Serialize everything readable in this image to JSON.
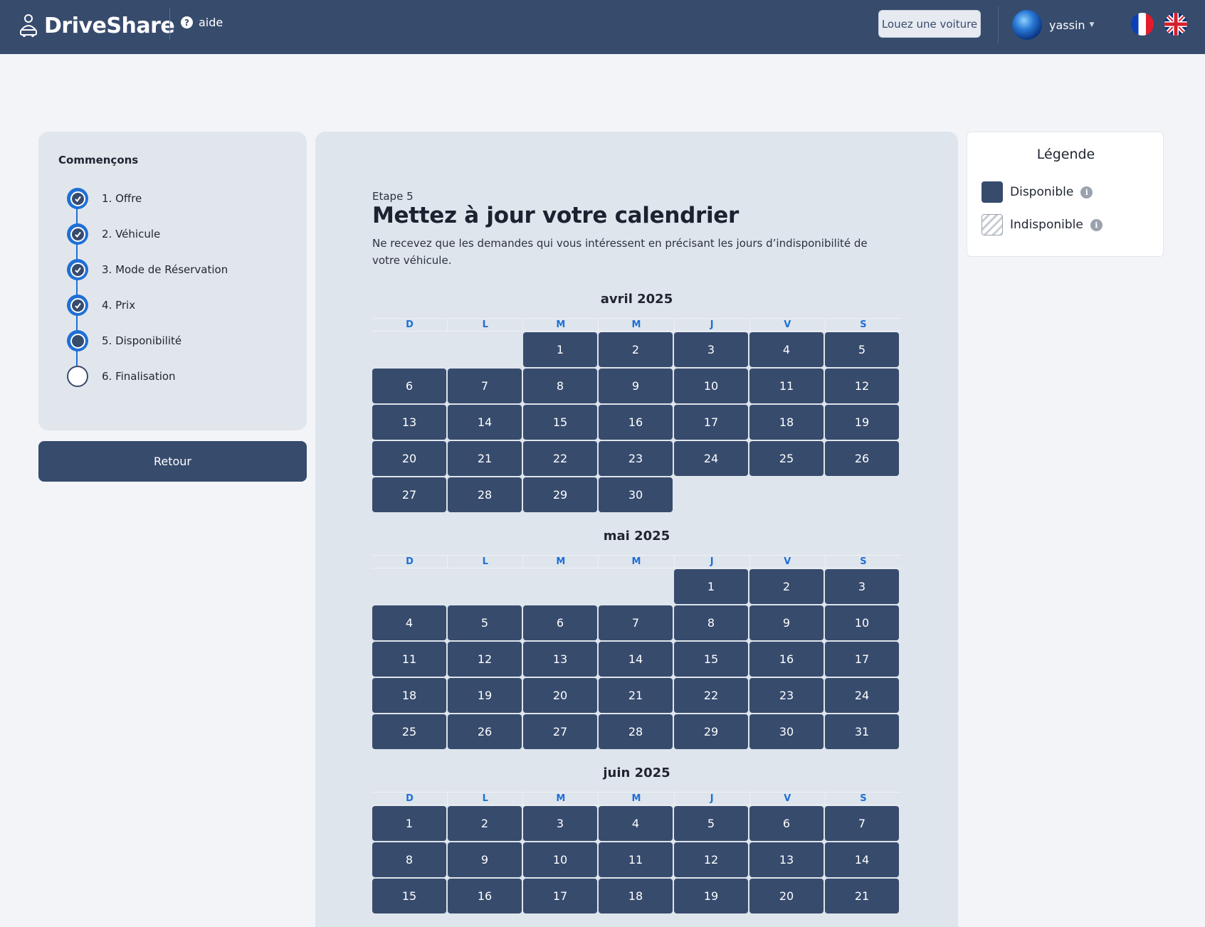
{
  "header": {
    "brand": "DriveShare",
    "help_label": "aide",
    "rent_button": "Louez une voiture",
    "username": "yassin"
  },
  "steps": {
    "title": "Commençons",
    "items": [
      {
        "label": "1. Offre",
        "status": "done"
      },
      {
        "label": "2. Véhicule",
        "status": "done"
      },
      {
        "label": "3. Mode de Réservation",
        "status": "done"
      },
      {
        "label": "4. Prix",
        "status": "done"
      },
      {
        "label": "5. Disponibilité",
        "status": "current"
      },
      {
        "label": "6. Finalisation",
        "status": "todo"
      }
    ],
    "back_button": "Retour"
  },
  "main": {
    "step_number": "Etape 5",
    "title": "Mettez à jour votre calendrier",
    "description": "Ne recevez que les demandes qui vous intéressent en précisant les jours d’indisponibilité de votre véhicule."
  },
  "weekdays": [
    "D",
    "L",
    "M",
    "M",
    "J",
    "V",
    "S"
  ],
  "months": [
    {
      "title": "avril 2025",
      "first_weekday": 2,
      "days": 30
    },
    {
      "title": "mai 2025",
      "first_weekday": 4,
      "days": 31
    },
    {
      "title": "juin 2025",
      "first_weekday": 0,
      "days": 21
    }
  ],
  "legend": {
    "title": "Légende",
    "available": "Disponible",
    "unavailable": "Indisponible"
  },
  "colors": {
    "primary": "#374b6d",
    "accent": "#1f6fd6",
    "panel": "#dfe5ec"
  }
}
